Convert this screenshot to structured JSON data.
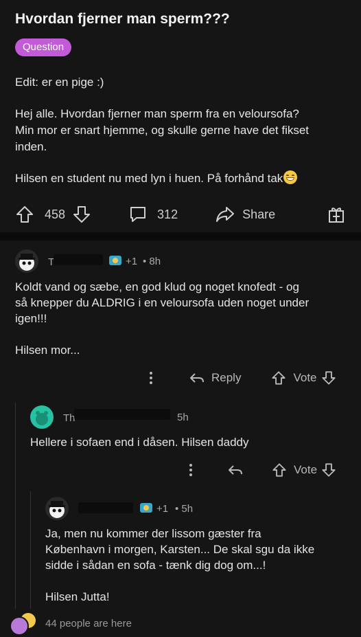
{
  "post": {
    "title": "Hvordan fjerner man sperm???",
    "flair": "Question",
    "edit_line": "Edit: er en pige :)",
    "paragraph1": [
      "Hej alle. Hvordan fjerner man sperm fra en veloursofa?",
      "Min mor er snart hjemme, og skulle gerne have det fikset",
      "inden."
    ],
    "paragraph2": "Hilsen en student nu med lyn i huen. På forhånd tak",
    "upvotes": "458",
    "comments": "312",
    "share_label": "Share"
  },
  "comments": [
    {
      "username": "T",
      "karma_badge": "+1",
      "time": "• 8h",
      "lines": [
        "Koldt vand og sæbe, en god klud og noget knofedt - og",
        "så knepper du ALDRIG i en veloursofa uden noget under",
        "igen!!!"
      ],
      "signoff": "Hilsen mor...",
      "reply_label": "Reply",
      "vote_label": "Vote"
    },
    {
      "username": "Th",
      "time": "5h",
      "lines": [
        "Hellere i sofaen end i dåsen. Hilsen daddy"
      ],
      "vote_label": "Vote"
    },
    {
      "username": "",
      "karma_badge": "+1",
      "time": "• 5h",
      "lines": [
        "Ja, men nu kommer der lissom gæster fra",
        "København i morgen, Karsten... De skal sgu da ikke",
        "sidde i sådan en sofa - tænk dig dog om...!"
      ],
      "signoff": "Hilsen Jutta!"
    }
  ],
  "footer": {
    "presence": "44 people are here"
  },
  "colors": {
    "flair": "#c35bd9",
    "background": "#151515",
    "text": "#e4e4e4"
  }
}
